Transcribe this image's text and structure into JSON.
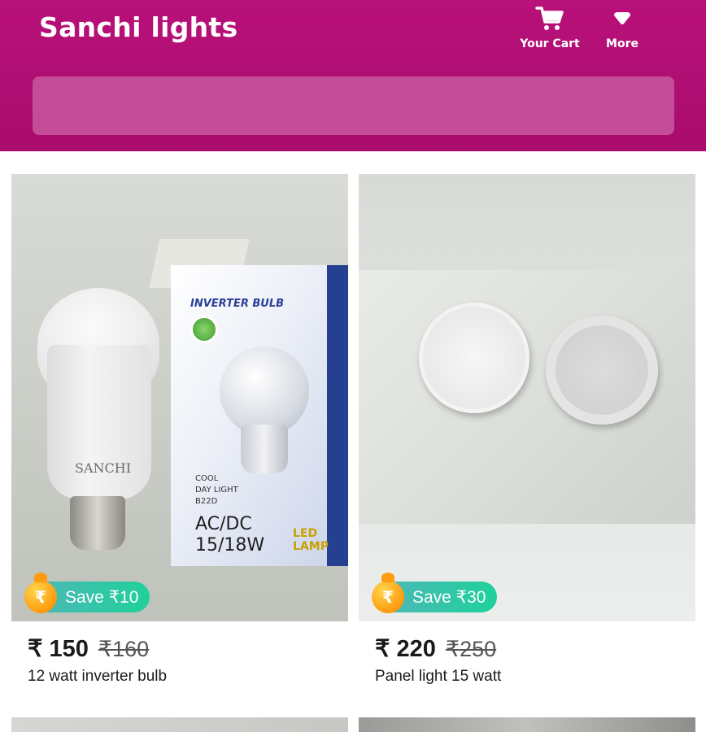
{
  "header": {
    "title": "Sanchi lights",
    "cart_label": "Your Cart",
    "more_label": "More",
    "background": "#b0106f",
    "cart_icon": "shopping-cart-icon",
    "more_icon": "chevron-down-icon"
  },
  "search": {
    "value": "",
    "placeholder": ""
  },
  "products": [
    {
      "image_text": {
        "bulb_brand": "SANCHI",
        "box_title": "INVERTER BULB",
        "box_small": [
          "COOL",
          "DAY LIGHT",
          "B22D"
        ],
        "box_watt": [
          "AC/DC",
          "15/18W"
        ],
        "box_led": "LED LAMP"
      },
      "save_label": "Save ₹10",
      "price": "₹ 150",
      "mrp": "₹160",
      "name": "12 watt inverter  bulb"
    },
    {
      "save_label": "Save ₹30",
      "price": "₹ 220",
      "mrp": "₹250",
      "name": "Panel light 15 watt"
    }
  ],
  "colors": {
    "accent": "#b0106f",
    "save_badge": "#2fc6a8",
    "coin": "#ff9b0f"
  }
}
